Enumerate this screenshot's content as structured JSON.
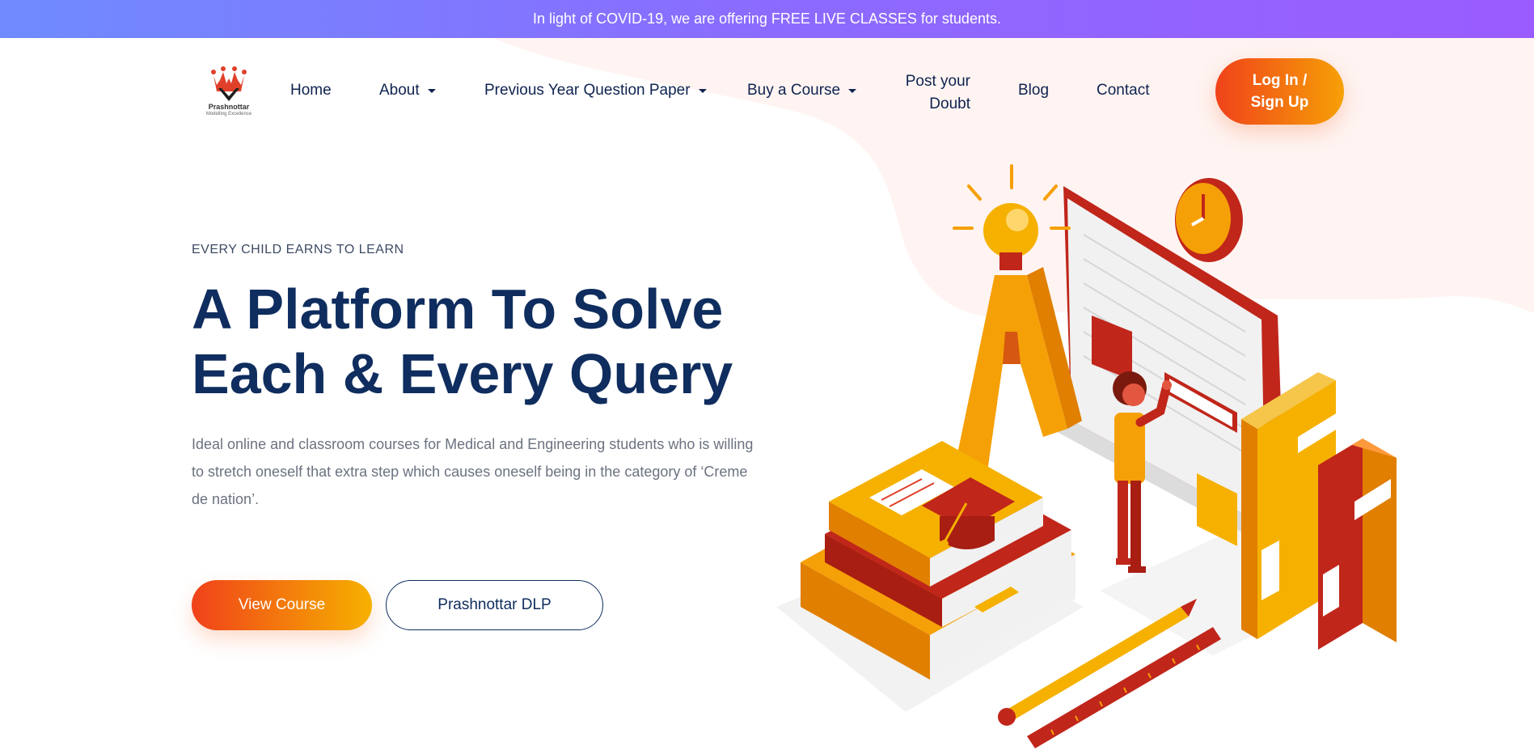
{
  "promo": {
    "text": "In light of COVID-19, we are offering FREE LIVE CLASSES for students."
  },
  "logo": {
    "name": "Prashnottar",
    "tagline": "Modelling Excellence"
  },
  "nav": {
    "home": "Home",
    "about": "About",
    "pyq": "Previous Year Question Paper",
    "buy_course": "Buy a Course",
    "post_doubt_line1": "Post your",
    "post_doubt_line2": "Doubt",
    "blog": "Blog",
    "contact": "Contact",
    "login_line1": "Log In /",
    "login_line2": "Sign Up"
  },
  "hero": {
    "eyebrow": "EVERY CHILD EARNS TO LEARN",
    "headline_line1": "A Platform To Solve",
    "headline_line2": "Each & Every Query",
    "description": "Ideal online and classroom courses for Medical and Engineering students who is willing to stretch oneself that extra step which causes oneself being in the category of ‘Creme de nation’.",
    "view_course": "View Course",
    "dlp": "Prashnottar DLP"
  },
  "colors": {
    "navy": "#0f2d5e",
    "accent_orange": "#f0421a",
    "accent_yellow": "#f6a007",
    "promo_gradient_start": "#6f8bff",
    "promo_gradient_end": "#9a5cff",
    "blob": "#fff4f2"
  },
  "illustration": {
    "icon": "education-isometric-illustration"
  }
}
